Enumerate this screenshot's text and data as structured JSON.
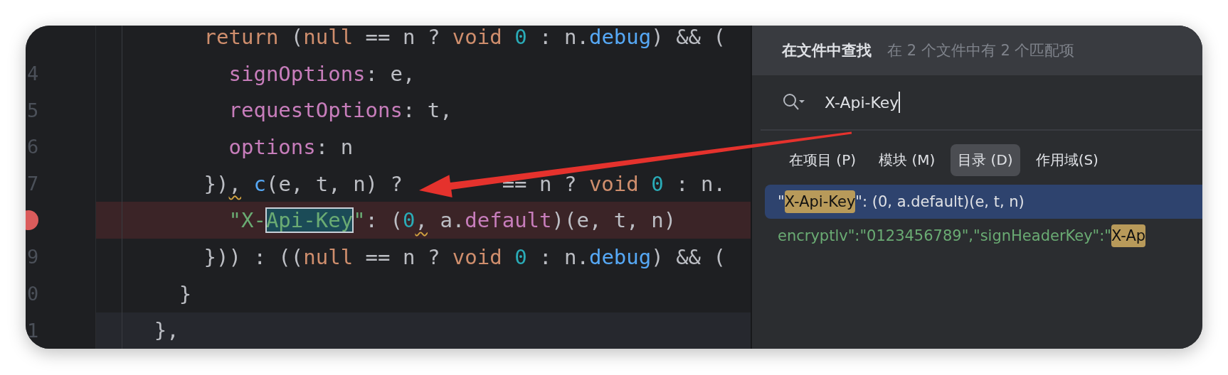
{
  "editor": {
    "lines": [
      {
        "breakpoint": false,
        "current": false,
        "tokens": [
          {
            "kind": "keyword",
            "text": "          return"
          },
          {
            "kind": "plain",
            "text": " ("
          },
          {
            "kind": "keyword",
            "text": "null"
          },
          {
            "kind": "plain",
            "text": " == n ? "
          },
          {
            "kind": "keyword",
            "text": "void "
          },
          {
            "kind": "number",
            "text": "0"
          },
          {
            "kind": "plain",
            "text": " : n."
          },
          {
            "kind": "function",
            "text": "debug"
          },
          {
            "kind": "plain",
            "text": ") && ("
          }
        ]
      },
      {
        "number": "4",
        "breakpoint": false,
        "current": false,
        "tokens": [
          {
            "kind": "property",
            "text": "            signOptions"
          },
          {
            "kind": "plain",
            "text": ": e,"
          }
        ]
      },
      {
        "number": "5",
        "breakpoint": false,
        "current": false,
        "tokens": [
          {
            "kind": "property",
            "text": "            requestOptions"
          },
          {
            "kind": "plain",
            "text": ": t,"
          }
        ]
      },
      {
        "number": "6",
        "breakpoint": false,
        "current": false,
        "tokens": [
          {
            "kind": "property",
            "text": "            options"
          },
          {
            "kind": "plain",
            "text": ": n"
          }
        ]
      },
      {
        "number": "7",
        "breakpoint": false,
        "current": false,
        "tokens": [
          {
            "kind": "plain",
            "text": "          })"
          },
          {
            "kind": "plain",
            "text": ",",
            "warning": true
          },
          {
            "kind": "function",
            "text": " c"
          },
          {
            "kind": "plain",
            "text": "(e, t, n) ?"
          },
          {
            "kind": "covered"
          },
          {
            "kind": "plain",
            "text": " == n ? "
          },
          {
            "kind": "keyword",
            "text": "void "
          },
          {
            "kind": "number",
            "text": "0"
          },
          {
            "kind": "plain",
            "text": " : n."
          }
        ]
      },
      {
        "breakpoint": true,
        "current": false,
        "tokens": [
          {
            "kind": "string",
            "text": "            \"X-"
          },
          {
            "kind": "string",
            "text": "Api-Key",
            "match": true
          },
          {
            "kind": "string",
            "text": "\""
          },
          {
            "kind": "plain",
            "text": ": ("
          },
          {
            "kind": "number",
            "text": "0"
          },
          {
            "kind": "plain",
            "text": ",",
            "warning": true
          },
          {
            "kind": "plain",
            "text": " a."
          },
          {
            "kind": "property",
            "text": "default"
          },
          {
            "kind": "plain",
            "text": ")(e, t, n)"
          }
        ]
      },
      {
        "number": "9",
        "breakpoint": false,
        "current": false,
        "tokens": [
          {
            "kind": "plain",
            "text": "          })) : (("
          },
          {
            "kind": "keyword",
            "text": "null"
          },
          {
            "kind": "plain",
            "text": " == n ? "
          },
          {
            "kind": "keyword",
            "text": "void "
          },
          {
            "kind": "number",
            "text": "0"
          },
          {
            "kind": "plain",
            "text": " : n."
          },
          {
            "kind": "function",
            "text": "debug"
          },
          {
            "kind": "plain",
            "text": ") && ("
          }
        ]
      },
      {
        "number": "0",
        "breakpoint": false,
        "current": false,
        "tokens": [
          {
            "kind": "plain",
            "text": "        }"
          }
        ]
      },
      {
        "number": "1",
        "breakpoint": false,
        "current": true,
        "tokens": [
          {
            "kind": "plain",
            "text": "      },"
          }
        ]
      }
    ]
  },
  "find_popup": {
    "title": "在文件中查找",
    "summary": "在 2 个文件中有 2 个匹配项",
    "query": "X-Api-Key",
    "scopes": [
      {
        "label": "在项目 (P)",
        "selected": false
      },
      {
        "label": "模块 (M)",
        "selected": false
      },
      {
        "label": "目录 (D)",
        "selected": true
      },
      {
        "label": "作用域(S)",
        "selected": false
      }
    ],
    "results": [
      {
        "kind": "code",
        "selected": true,
        "parts": [
          {
            "text": "\"",
            "match": false
          },
          {
            "text": "X-Api-Key",
            "match": true
          },
          {
            "text": "\": (0, a.default)(e, t, n)",
            "match": false
          }
        ]
      },
      {
        "kind": "string",
        "selected": false,
        "parts": [
          {
            "text": "encryptlv\":\"0123456789\",\"signHeaderKey\":\"",
            "match": false
          },
          {
            "text": "X-Ap",
            "match": true
          }
        ]
      }
    ]
  },
  "annotations": [
    {
      "kind": "arrow"
    }
  ]
}
